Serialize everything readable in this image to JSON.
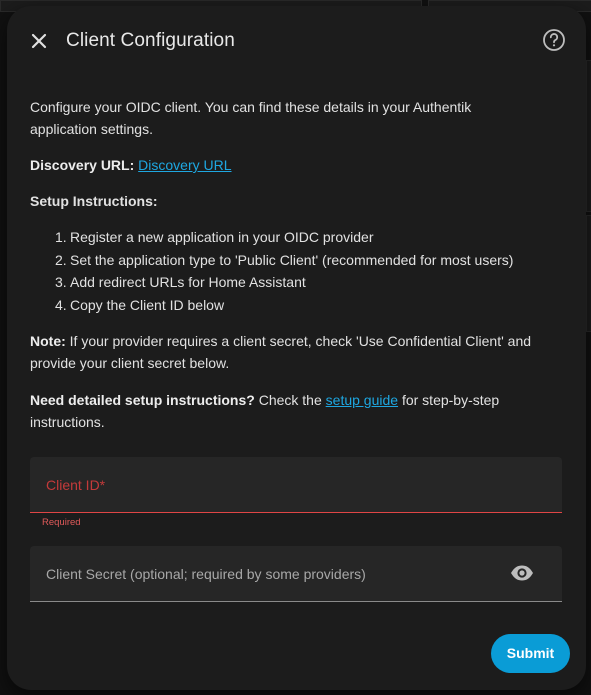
{
  "dialog": {
    "title": "Client Configuration",
    "close_icon": "close-icon",
    "help_icon": "help-circle-icon"
  },
  "content": {
    "intro": "Configure your OIDC client. You can find these details in your Authentik application settings.",
    "discovery_label": "Discovery URL:",
    "discovery_link": "Discovery URL",
    "setup_heading": "Setup Instructions:",
    "steps": [
      {
        "num": "1.",
        "text": "Register a new application in your OIDC provider"
      },
      {
        "num": "2.",
        "text": "Set the application type to 'Public Client' (recommended for most users)"
      },
      {
        "num": "3.",
        "text": "Add redirect URLs for Home Assistant"
      },
      {
        "num": "4.",
        "text": "Copy the Client ID below"
      }
    ],
    "note_label": "Note:",
    "note_text": " If your provider requires a client secret, check 'Use Confidential Client' and provide your client secret below.",
    "need_label": "Need detailed setup instructions?",
    "need_pre": " Check the ",
    "need_link": "setup guide",
    "need_post": " for step-by-step instructions."
  },
  "form": {
    "client_id_label": "Client ID*",
    "client_id_value": "",
    "client_id_error": "Required",
    "client_secret_label": "Client Secret (optional; required by some providers)",
    "client_secret_value": "",
    "visibility_icon": "eye-icon"
  },
  "actions": {
    "submit_label": "Submit"
  },
  "colors": {
    "accent": "#0a9cd6",
    "error": "#e04545",
    "link": "#1ea7e1",
    "dialog_bg": "#1c1c1c"
  }
}
